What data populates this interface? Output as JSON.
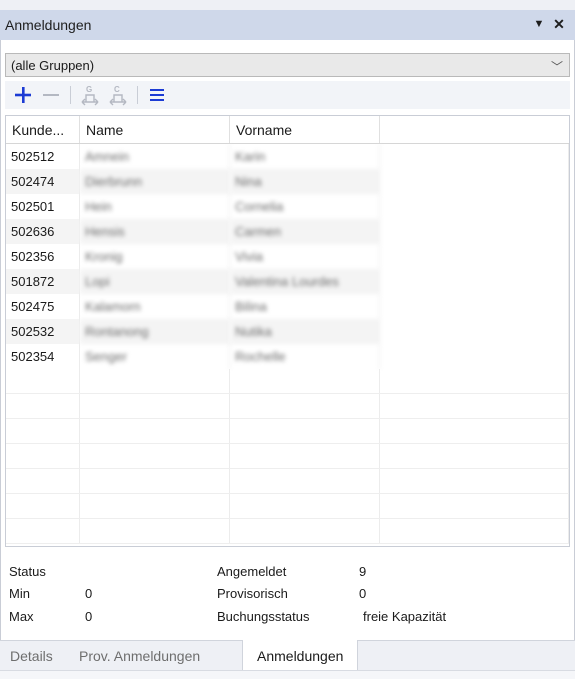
{
  "panel": {
    "title": "Anmeldungen"
  },
  "group_filter": {
    "selected": "(alle Gruppen)"
  },
  "toolbar": {
    "icons": [
      "plus-icon",
      "minus-icon",
      "group-g-icon",
      "group-c-icon",
      "menu-icon"
    ]
  },
  "grid": {
    "columns": [
      "Kunde...",
      "Name",
      "Vorname"
    ],
    "rows": [
      {
        "kunde": "502512",
        "name": "Amnein",
        "vorname": "Karin"
      },
      {
        "kunde": "502474",
        "name": "Dierbrunn",
        "vorname": "Nina"
      },
      {
        "kunde": "502501",
        "name": "Hein",
        "vorname": "Cornelia"
      },
      {
        "kunde": "502636",
        "name": "Hensis",
        "vorname": "Carmen"
      },
      {
        "kunde": "502356",
        "name": "Kronig",
        "vorname": "Vivia"
      },
      {
        "kunde": "501872",
        "name": "Lopi",
        "vorname": "Valentina Lourdes"
      },
      {
        "kunde": "502475",
        "name": "Kalamorn",
        "vorname": "Bilina"
      },
      {
        "kunde": "502532",
        "name": "Rontanong",
        "vorname": "Nutika"
      },
      {
        "kunde": "502354",
        "name": "Senger",
        "vorname": "Rochelle"
      }
    ]
  },
  "summary": {
    "status_label": "Status",
    "min_label": "Min",
    "min_value": "0",
    "max_label": "Max",
    "max_value": "0",
    "angemeldet_label": "Angemeldet",
    "angemeldet_value": "9",
    "provisorisch_label": "Provisorisch",
    "provisorisch_value": "0",
    "buchungsstatus_label": "Buchungsstatus",
    "buchungsstatus_value": "freie Kapazität"
  },
  "tabs": [
    {
      "label": "Details",
      "active": false
    },
    {
      "label": "Prov. Anmeldungen",
      "active": false
    },
    {
      "label": "Anmeldungen",
      "active": true
    }
  ],
  "colors": {
    "accent": "#1c3bd4",
    "titlebar": "#cfd8ea"
  }
}
